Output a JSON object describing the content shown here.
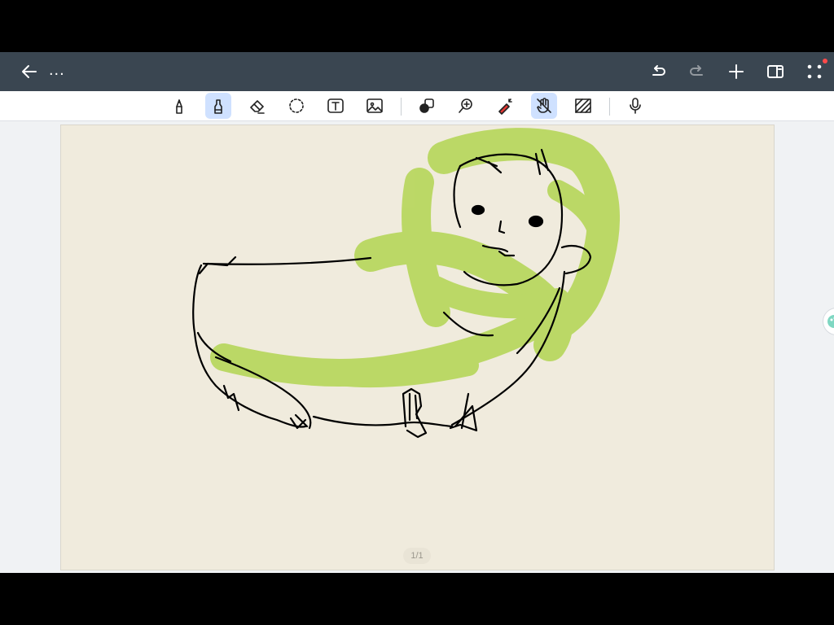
{
  "app_bar": {
    "title": "...",
    "back_icon": "arrow-left-icon",
    "undo_icon": "undo-icon",
    "redo_icon": "redo-icon",
    "add_icon": "plus-icon",
    "panel_icon": "side-panel-icon",
    "more_icon": "grid-dots-icon",
    "notification_color": "#ff4a4a"
  },
  "toolbar": {
    "tools": [
      {
        "name": "pen",
        "icon": "pen-icon",
        "active": false
      },
      {
        "name": "highlighter",
        "icon": "highlighter-icon",
        "active": true
      },
      {
        "name": "eraser",
        "icon": "eraser-icon",
        "active": false
      },
      {
        "name": "lasso",
        "icon": "lasso-icon",
        "active": false
      },
      {
        "name": "text",
        "icon": "text-box-icon",
        "active": false
      },
      {
        "name": "image",
        "icon": "image-icon",
        "active": false
      },
      {
        "name": "shapes",
        "icon": "shapes-icon",
        "active": false
      },
      {
        "name": "zoom",
        "icon": "zoom-in-icon",
        "active": false
      },
      {
        "name": "laser",
        "icon": "laser-pointer-icon",
        "active": false
      },
      {
        "name": "hand-writing-mode",
        "icon": "hand-off-icon",
        "active": true
      },
      {
        "name": "pattern",
        "icon": "hatch-pattern-icon",
        "active": false
      },
      {
        "name": "record",
        "icon": "microphone-icon",
        "active": false
      }
    ],
    "active_color": "#cfe1ff"
  },
  "page": {
    "indicator": "1/1",
    "paper_color": "#f0ebdd",
    "highlight_color": "#b6d65a"
  }
}
